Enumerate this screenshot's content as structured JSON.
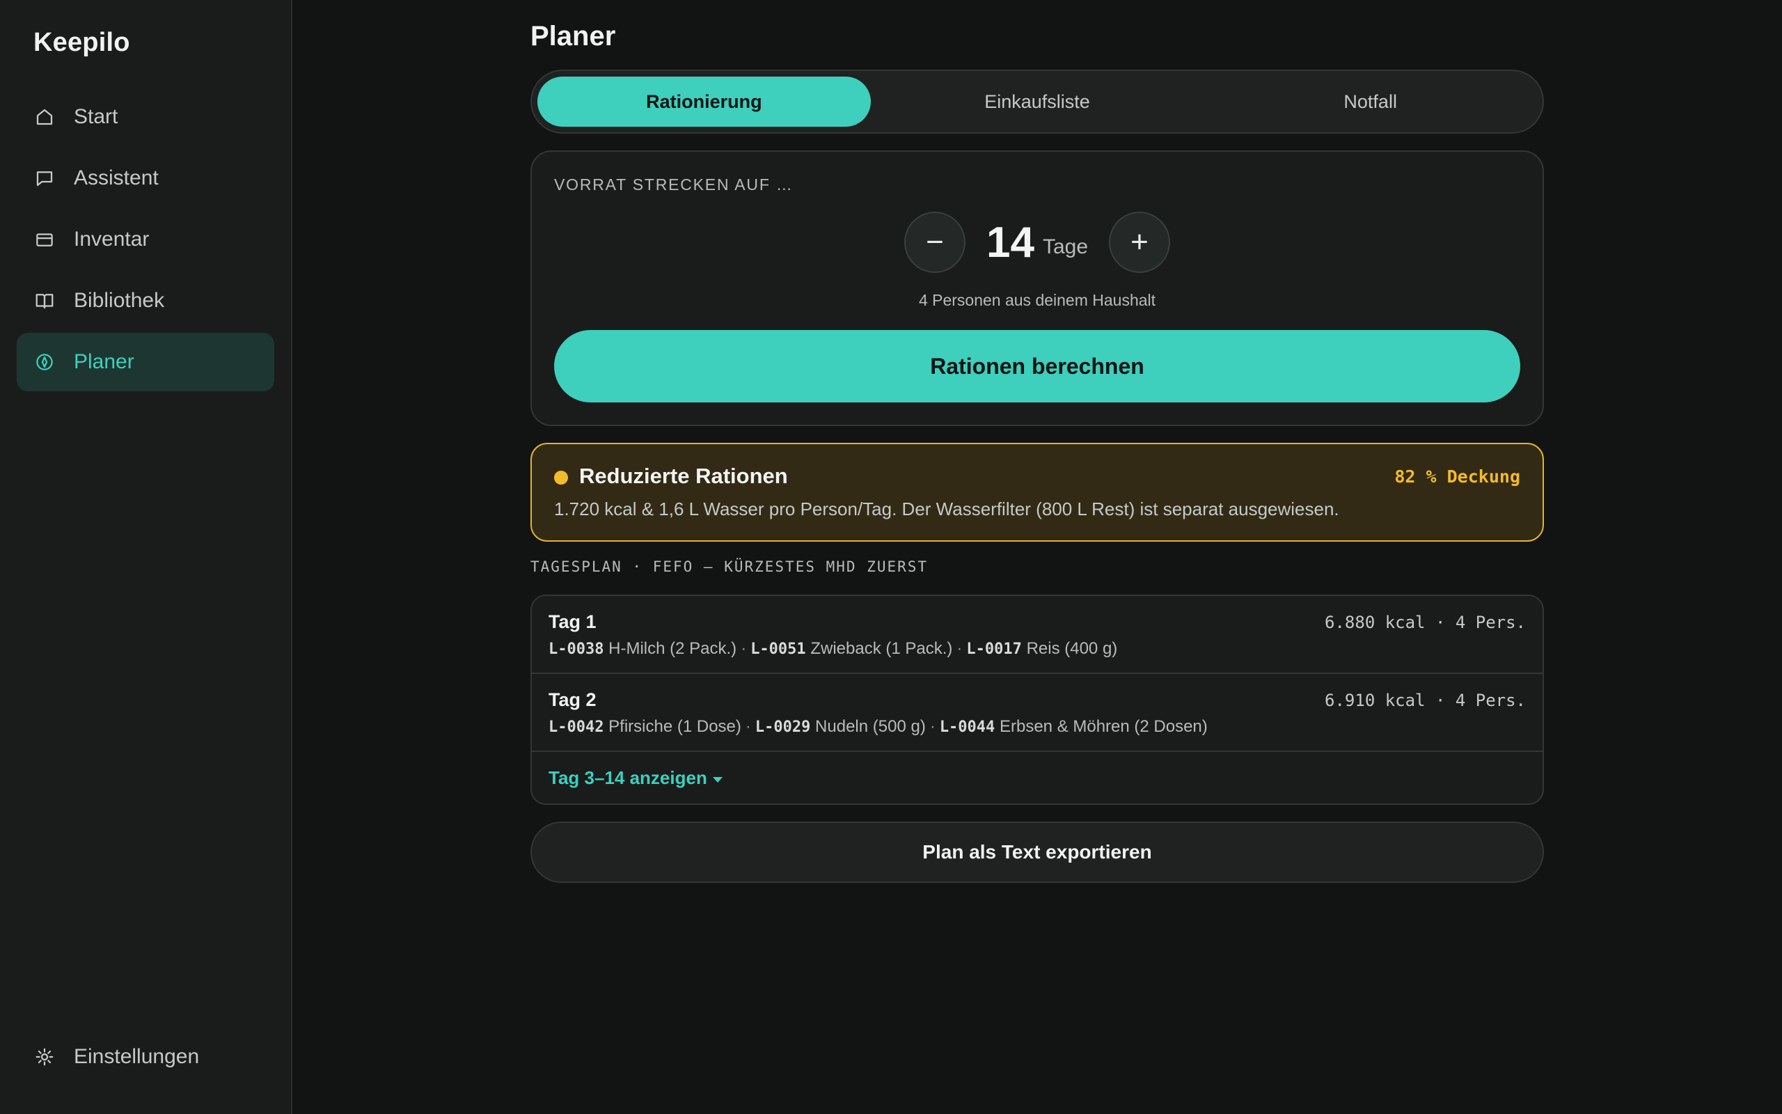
{
  "app": {
    "brand": "Keepilo"
  },
  "sidebar": {
    "items": [
      {
        "label": "Start",
        "icon": "home-icon"
      },
      {
        "label": "Assistent",
        "icon": "chat-icon"
      },
      {
        "label": "Inventar",
        "icon": "inventory-icon"
      },
      {
        "label": "Bibliothek",
        "icon": "book-icon"
      },
      {
        "label": "Planer",
        "icon": "planner-icon",
        "active": true
      }
    ],
    "settings": {
      "label": "Einstellungen",
      "icon": "gear-icon"
    }
  },
  "page": {
    "title": "Planer"
  },
  "tabs": [
    {
      "label": "Rationierung",
      "active": true
    },
    {
      "label": "Einkaufsliste"
    },
    {
      "label": "Notfall"
    }
  ],
  "rationing": {
    "label": "VORRAT STRECKEN AUF …",
    "minus": "−",
    "plus": "+",
    "days": "14",
    "unit": "Tage",
    "household": "4 Personen aus deinem Haushalt",
    "calculate": "Rationen berechnen"
  },
  "warning": {
    "title": "Reduzierte Rationen",
    "coverage": "82 % Deckung",
    "description": "1.720 kcal & 1,6 L Wasser pro Person/Tag. Der Wasserfilter (800 L Rest) ist separat ausgewiesen."
  },
  "plan": {
    "section_label": "TAGESPLAN · FEFO — KÜRZESTES MHD ZUERST",
    "days": [
      {
        "name": "Tag 1",
        "meta": "6.880 kcal · 4 Pers.",
        "items": [
          {
            "code": "L-0038",
            "text": "H-Milch (2 Pack.)"
          },
          {
            "code": "L-0051",
            "text": "Zwieback (1 Pack.)"
          },
          {
            "code": "L-0017",
            "text": "Reis (400 g)"
          }
        ]
      },
      {
        "name": "Tag 2",
        "meta": "6.910 kcal · 4 Pers.",
        "items": [
          {
            "code": "L-0042",
            "text": "Pfirsiche (1 Dose)"
          },
          {
            "code": "L-0029",
            "text": "Nudeln (500 g)"
          },
          {
            "code": "L-0044",
            "text": "Erbsen & Möhren (2 Dosen)"
          }
        ]
      }
    ],
    "show_more": "Tag 3–14 anzeigen",
    "export": "Plan als Text exportieren"
  },
  "colors": {
    "accent": "#3ecfbd",
    "warning": "#f2bb2a",
    "background": "#121413",
    "sidebar": "#1a1c1b"
  }
}
